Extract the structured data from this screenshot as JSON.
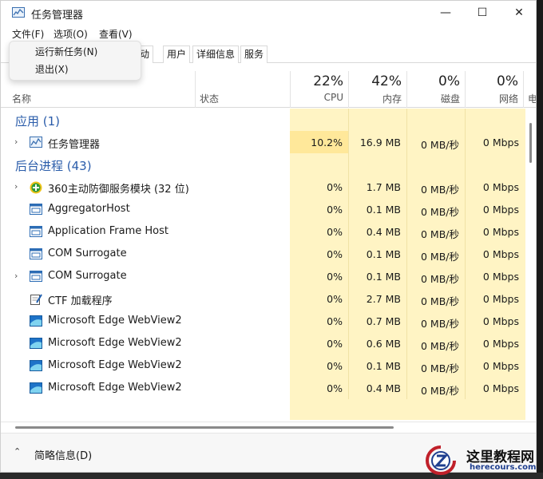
{
  "window": {
    "title": "任务管理器"
  },
  "title_buttons": {
    "minimize": "—",
    "maximize": "☐",
    "close": "✕"
  },
  "menu": {
    "file": "文件(F)",
    "options": "选项(O)",
    "view": "查看(V)"
  },
  "file_menu_items": [
    "运行新任务(N)",
    "退出(X)"
  ],
  "tabs": [
    "启动",
    "用户",
    "详细信息",
    "服务"
  ],
  "tabs_visible_fragment": "动",
  "header": {
    "name": "名称",
    "status": "状态",
    "cpu_percent": "22%",
    "cpu_label": "CPU",
    "memory_percent": "42%",
    "memory_label": "内存",
    "disk_percent": "0%",
    "disk_label": "磁盘",
    "network_percent": "0%",
    "network_label": "网络",
    "more_label": "电"
  },
  "groups": {
    "apps": "应用 (1)",
    "background": "后台进程 (43)"
  },
  "processes": [
    {
      "name": "任务管理器",
      "expandable": true,
      "icon": "task-manager-icon",
      "cpu": "10.2%",
      "memory": "16.9 MB",
      "disk": "0 MB/秒",
      "network": "0 Mbps"
    },
    {
      "name": "360主动防御服务模块 (32 位)",
      "expandable": true,
      "icon": "360-security-icon",
      "cpu": "0%",
      "memory": "1.7 MB",
      "disk": "0 MB/秒",
      "network": "0 Mbps"
    },
    {
      "name": "AggregatorHost",
      "expandable": false,
      "icon": "app-window-icon",
      "cpu": "0%",
      "memory": "0.1 MB",
      "disk": "0 MB/秒",
      "network": "0 Mbps"
    },
    {
      "name": "Application Frame Host",
      "expandable": false,
      "icon": "app-window-icon",
      "cpu": "0%",
      "memory": "0.4 MB",
      "disk": "0 MB/秒",
      "network": "0 Mbps"
    },
    {
      "name": "COM Surrogate",
      "expandable": false,
      "icon": "app-window-icon",
      "cpu": "0%",
      "memory": "0.1 MB",
      "disk": "0 MB/秒",
      "network": "0 Mbps"
    },
    {
      "name": "COM Surrogate",
      "expandable": true,
      "icon": "app-window-icon",
      "cpu": "0%",
      "memory": "0.1 MB",
      "disk": "0 MB/秒",
      "network": "0 Mbps"
    },
    {
      "name": "CTF 加载程序",
      "expandable": false,
      "icon": "ctf-loader-icon",
      "cpu": "0%",
      "memory": "2.7 MB",
      "disk": "0 MB/秒",
      "network": "0 Mbps"
    },
    {
      "name": "Microsoft Edge WebView2",
      "expandable": false,
      "icon": "edge-webview-icon",
      "cpu": "0%",
      "memory": "0.7 MB",
      "disk": "0 MB/秒",
      "network": "0 Mbps"
    },
    {
      "name": "Microsoft Edge WebView2",
      "expandable": false,
      "icon": "edge-webview-icon",
      "cpu": "0%",
      "memory": "0.6 MB",
      "disk": "0 MB/秒",
      "network": "0 Mbps"
    },
    {
      "name": "Microsoft Edge WebView2",
      "expandable": false,
      "icon": "edge-webview-icon",
      "cpu": "0%",
      "memory": "0.1 MB",
      "disk": "0 MB/秒",
      "network": "0 Mbps"
    },
    {
      "name": "Microsoft Edge WebView2",
      "expandable": false,
      "icon": "edge-webview-icon",
      "cpu": "0%",
      "memory": "0.4 MB",
      "disk": "0 MB/秒",
      "network": "0 Mbps"
    }
  ],
  "footer": {
    "fewer_details": "简略信息(D)"
  },
  "watermark": {
    "title": "这里教程网",
    "url": "herecours.com"
  },
  "colors": {
    "group_text": "#2a5caa",
    "usage_bg": "#fff4c4",
    "usage_hot": "#ffe89a"
  }
}
